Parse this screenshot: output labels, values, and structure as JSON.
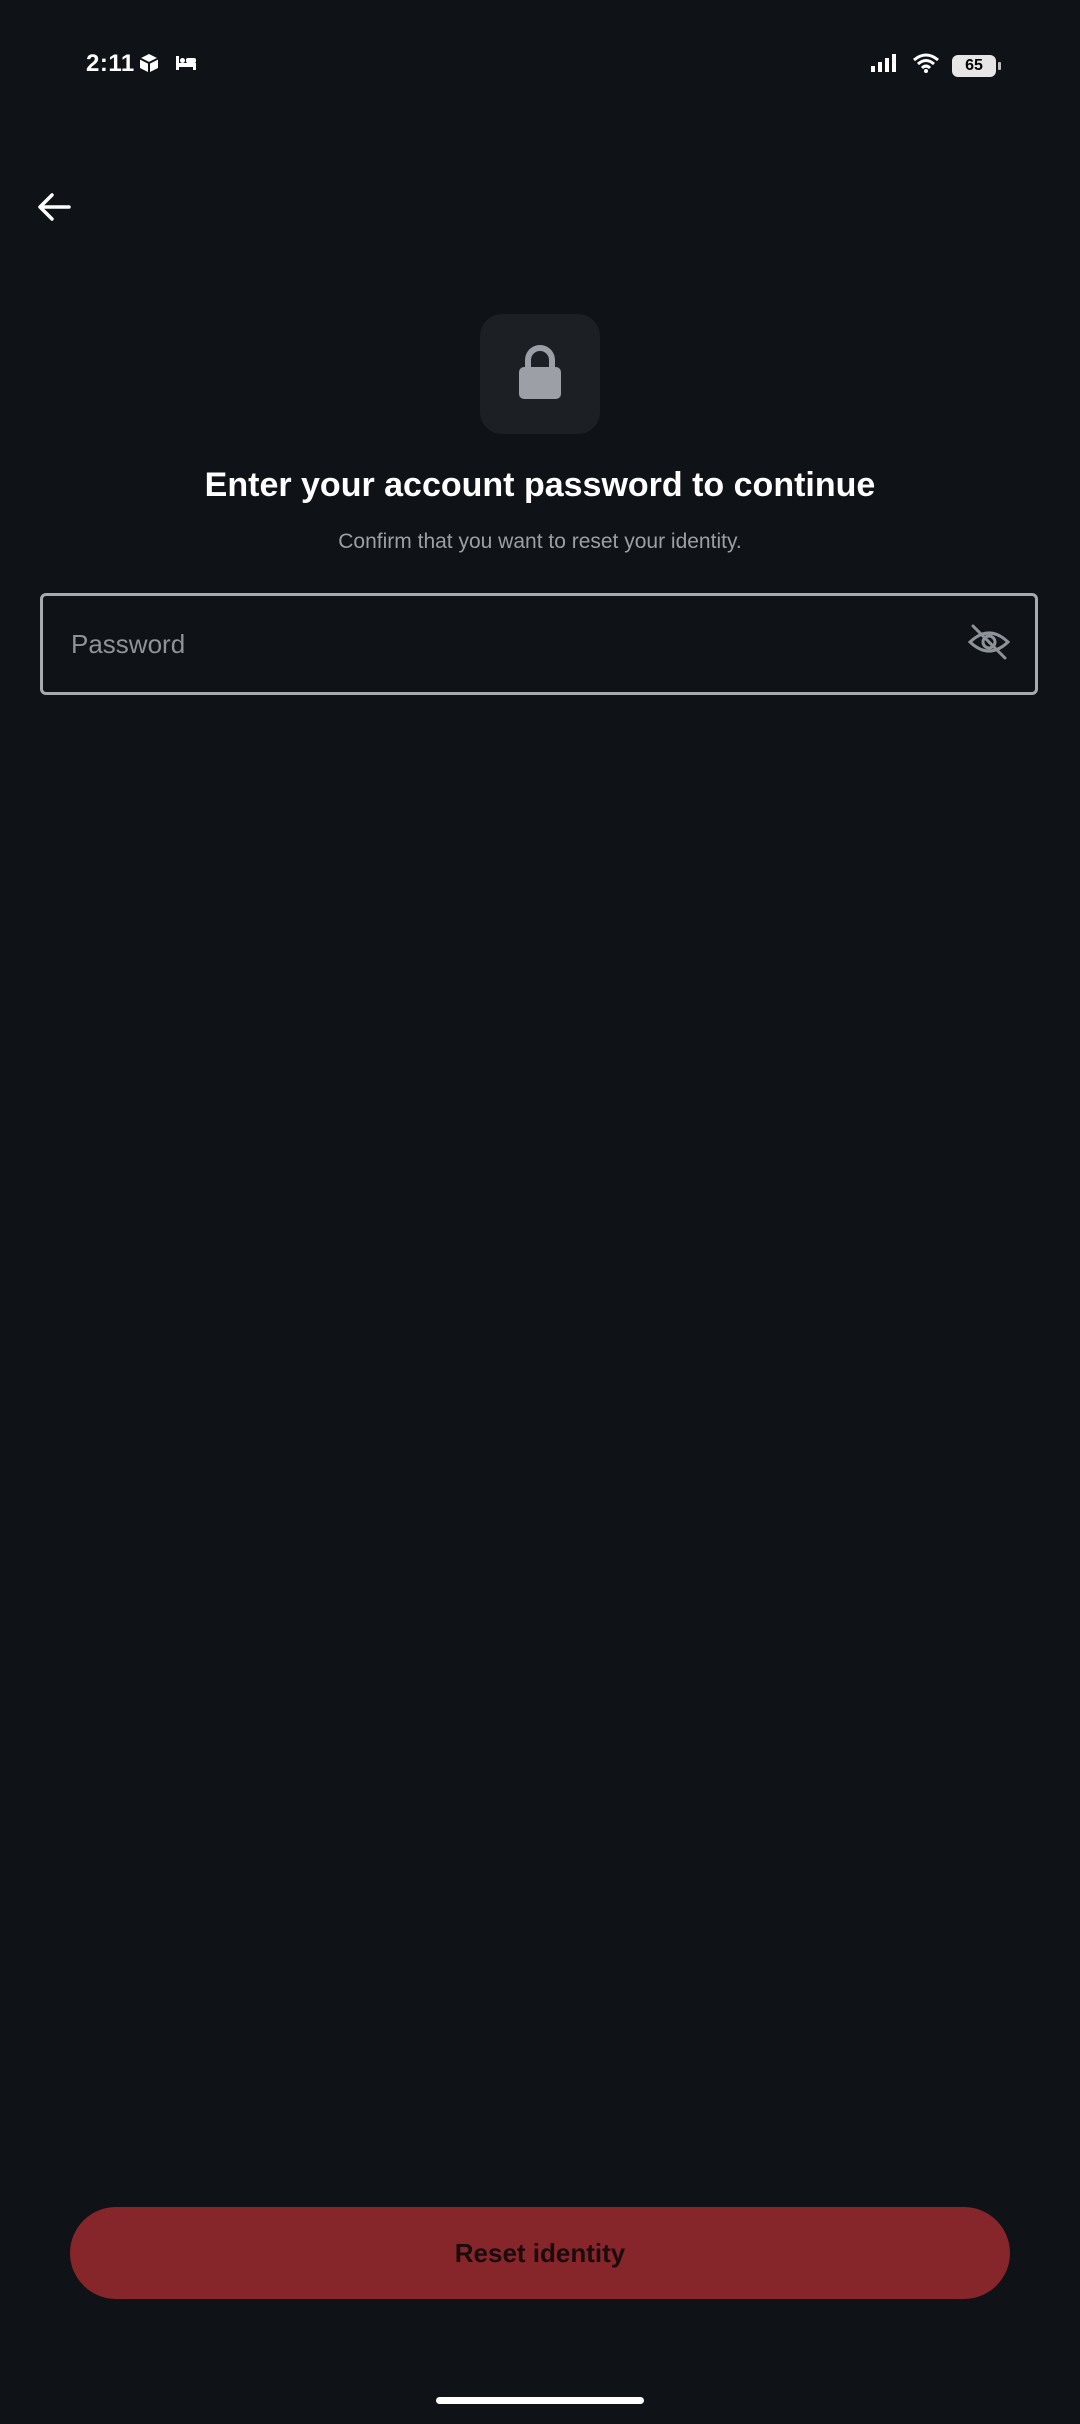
{
  "status_bar": {
    "time": "2:11",
    "battery": "65",
    "left_icons": [
      "box-notification-icon",
      "bed-icon"
    ],
    "right_icons": [
      "signal-icon",
      "wifi-icon",
      "battery-icon"
    ]
  },
  "navigation": {
    "back_icon": "arrow-left-icon"
  },
  "header": {
    "icon": "lock-icon",
    "title": "Enter your account password to continue",
    "subtitle": "Confirm that you want to reset your identity."
  },
  "password_field": {
    "placeholder": "Password",
    "value": "",
    "toggle_icon": "eye-off-icon"
  },
  "actions": {
    "reset_label": "Reset identity"
  },
  "colors": {
    "background": "#0f1217",
    "destructive_button": "#86252a",
    "field_border": "#a6abb1",
    "muted_text": "#9aa0a6"
  }
}
